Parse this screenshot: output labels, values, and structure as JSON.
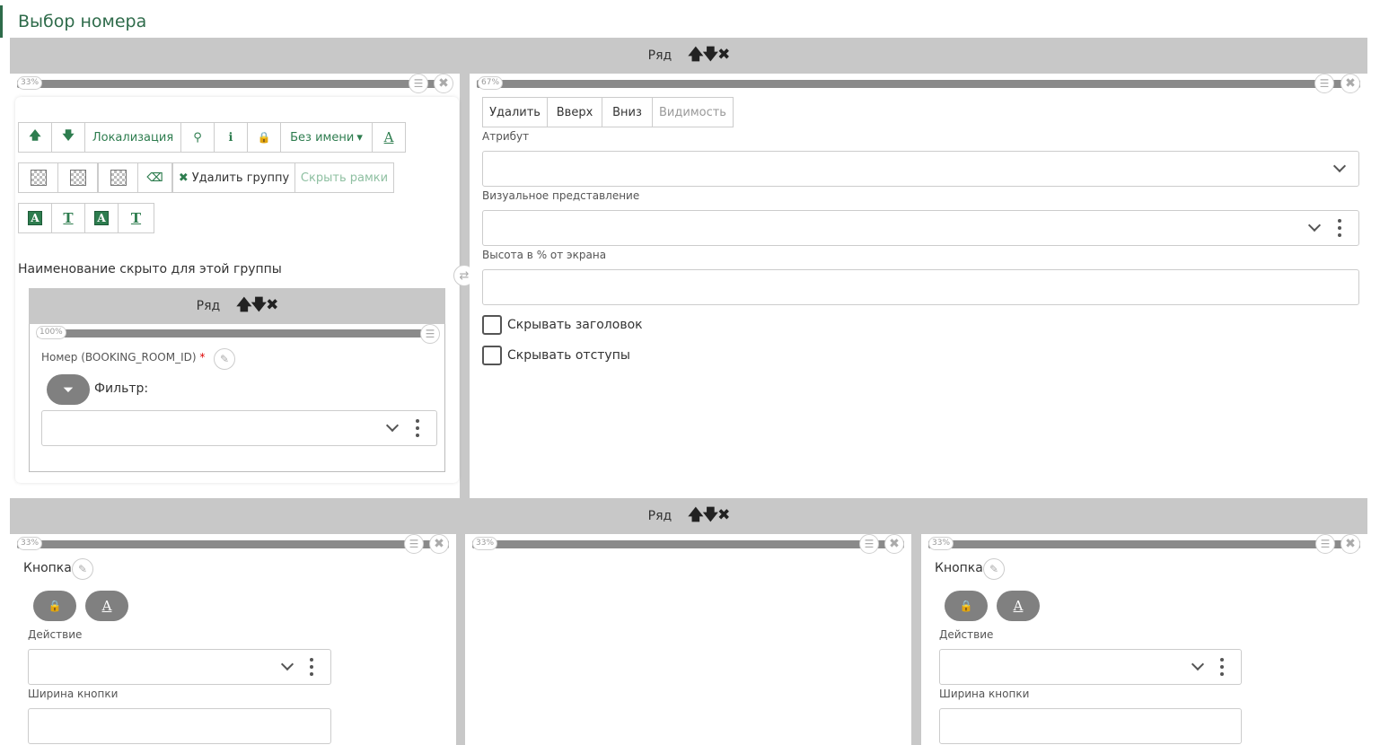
{
  "page": {
    "title": "Выбор номера"
  },
  "row_label": "Ряд",
  "row_controls": "🡅🡇✖",
  "icons": {
    "up": "🡅",
    "down": "🡇",
    "close": "✖",
    "list": "☰",
    "edit": "✎",
    "swap": "⇄",
    "binoculars": "⚲",
    "info": "ℹ",
    "lock": "🔒",
    "eraser": "⌫",
    "filter": "⏷",
    "letter": "A"
  },
  "top_row": {
    "left_col": {
      "percent": "33%",
      "toolbar1": {
        "localization": "Локализация",
        "no_name": "Без имени",
        "caret": "▾"
      },
      "toolbar2": {
        "delete_group": "Удалить группу",
        "hide_borders": "Скрыть рамки"
      },
      "format_buttons": [
        "A",
        "T",
        "A",
        "T"
      ],
      "hidden_name_note": "Наименование скрыто для этой группы",
      "inner": {
        "percent": "100%",
        "field_label": "Номер (BOOKING_ROOM_ID)",
        "required_mark": "*",
        "filter_label": "Фильтр:"
      }
    },
    "right_col": {
      "percent": "67%",
      "buttons": {
        "delete": "Удалить",
        "up": "Вверх",
        "down": "Вниз",
        "visibility": "Видимость"
      },
      "attribute_label": "Атрибут",
      "visual_label": "Визуальное представление",
      "height_label": "Высота в % от экрана",
      "hide_header": "Скрывать заголовок",
      "hide_padding": "Скрывать отступы"
    }
  },
  "bottom_row": {
    "col1": {
      "percent": "33%",
      "title": "Кнопка",
      "action_label": "Действие",
      "width_label": "Ширина кнопки"
    },
    "col2": {
      "percent": "33%"
    },
    "col3": {
      "percent": "33%",
      "title": "Кнопка",
      "action_label": "Действие",
      "width_label": "Ширина кнопки"
    }
  }
}
